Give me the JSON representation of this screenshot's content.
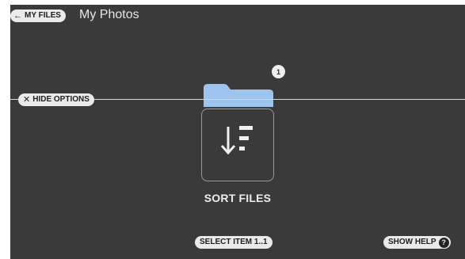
{
  "header": {
    "back_label": "MY FILES",
    "title": "My Photos"
  },
  "folder": {
    "count": "1",
    "color": "#9ec3ec"
  },
  "options": {
    "hide_label": "HIDE OPTIONS"
  },
  "sort": {
    "label": "SORT FILES",
    "icon": "sort-descending-icon"
  },
  "footer": {
    "select_label": "SELECT ITEM 1..1",
    "help_label": "SHOW HELP",
    "help_icon": "?"
  }
}
